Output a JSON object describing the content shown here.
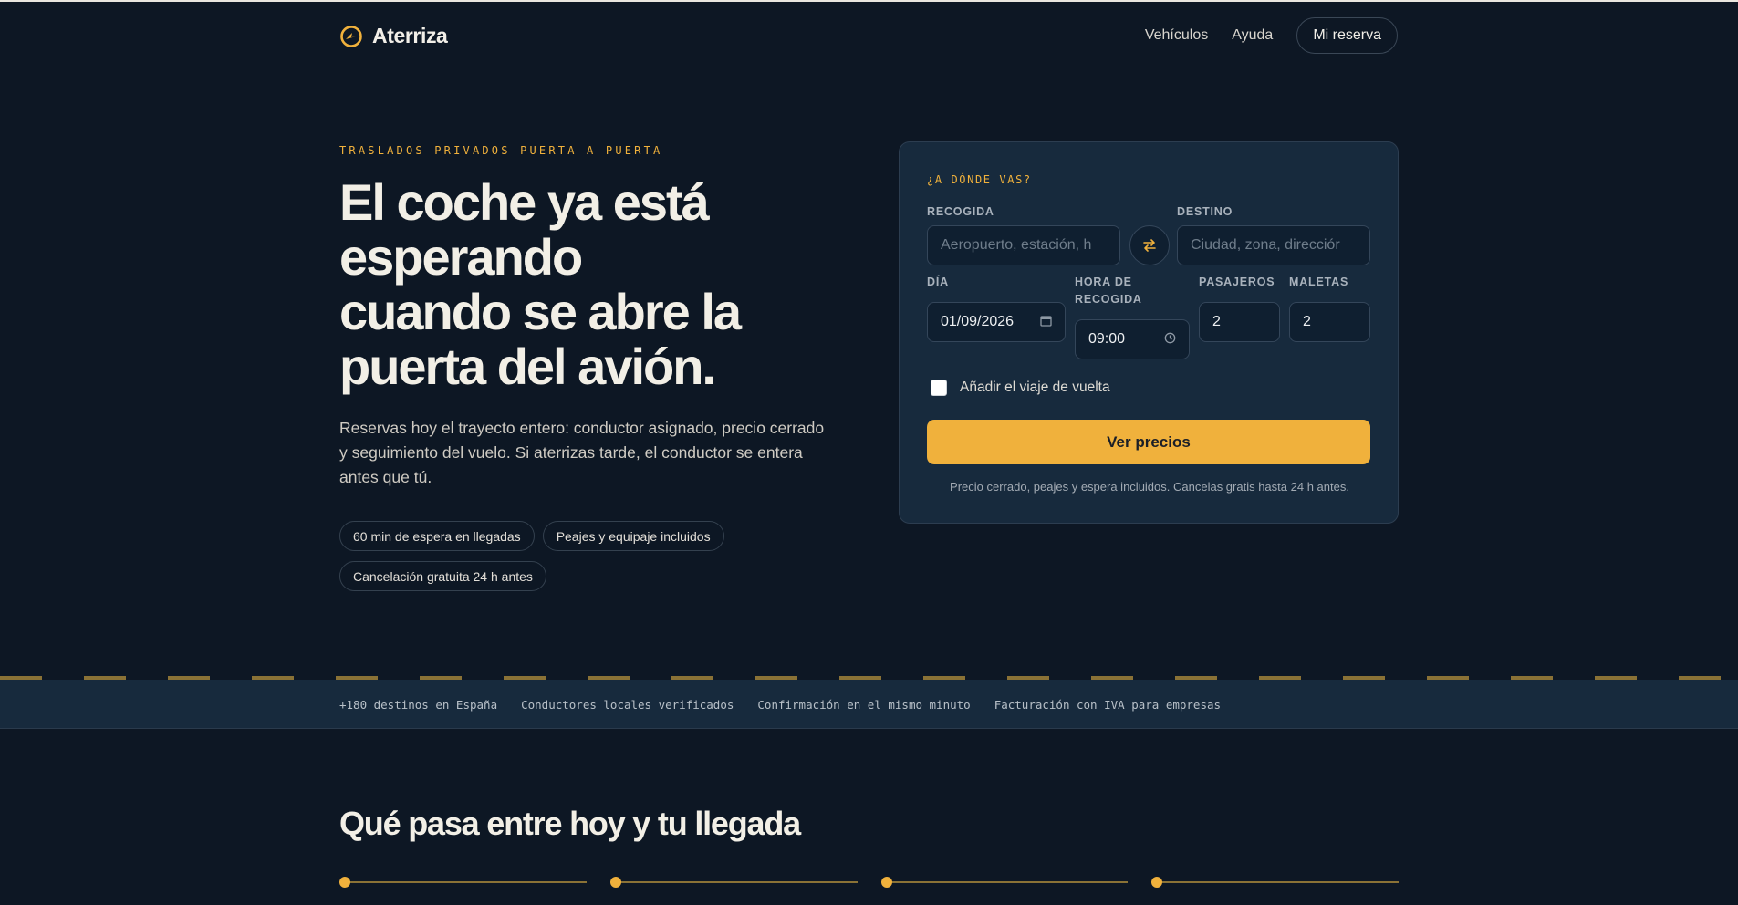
{
  "header": {
    "brand": "Aterriza",
    "nav": [
      "Vehículos",
      "Ayuda"
    ],
    "reservation_button": "Mi reserva"
  },
  "hero": {
    "eyebrow": "TRASLADOS PRIVADOS PUERTA A PUERTA",
    "title_lines": [
      "El coche ya está",
      "esperando",
      "cuando se abre la",
      "puerta del avión."
    ],
    "subtitle": "Reservas hoy el trayecto entero: conductor asignado, precio cerrado y seguimiento del vuelo. Si aterrizas tarde, el conductor se entera antes que tú.",
    "chips": [
      "60 min de espera en llegadas",
      "Peajes y equipaje incluidos",
      "Cancelación gratuita 24 h antes"
    ]
  },
  "booking": {
    "eyebrow": "¿A DÓNDE VAS?",
    "pickup_label": "RECOGIDA",
    "pickup_placeholder": "Aeropuerto, estación, h",
    "destination_label": "DESTINO",
    "destination_placeholder": "Ciudad, zona, direcciór",
    "day_label": "DÍA",
    "day_value": "01/09/2026",
    "time_label": "HORA DE RECOGIDA",
    "time_value": "09:00",
    "passengers_label": "PASAJEROS",
    "passengers_value": "2",
    "luggage_label": "MALETAS",
    "luggage_value": "2",
    "return_trip_label": "Añadir el viaje de vuelta",
    "return_trip_checked": false,
    "cta": "Ver precios",
    "note": "Precio cerrado, peajes y espera incluidos. Cancelas gratis hasta 24 h antes."
  },
  "band": [
    "+180 destinos en España",
    "Conductores locales verificados",
    "Confirmación en el mismo minuto",
    "Facturación con IVA para empresas"
  ],
  "section": {
    "title": "Qué pasa entre hoy y tu llegada",
    "timeline_steps": 4
  },
  "colors": {
    "background": "#0d1724",
    "card": "#172a3d",
    "accent": "#f0b13c"
  }
}
